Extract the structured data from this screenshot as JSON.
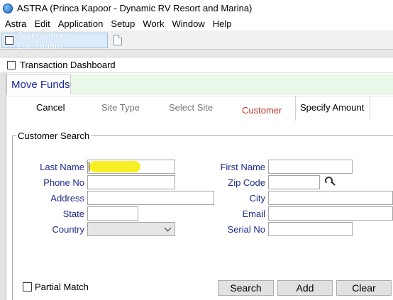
{
  "window": {
    "title": "ASTRA (Princa Kapoor - Dynamic RV Resort and Marina)"
  },
  "menu": [
    "Astra",
    "Edit",
    "Application",
    "Setup",
    "Work",
    "Window",
    "Help"
  ],
  "doc_tab": {
    "label": "Transaction Dashboard"
  },
  "inner_window": {
    "title": "Transaction Dashboard"
  },
  "page_tab": {
    "label": "Move Funds"
  },
  "steps": {
    "cancel": "Cancel",
    "site_type": "Site Type",
    "select_site": "Select Site",
    "customer": "Customer",
    "specify_amount": "Specify Amount"
  },
  "group": {
    "label": "Customer Search"
  },
  "form": {
    "last_name": {
      "label": "Last Name",
      "value": ""
    },
    "phone_no": {
      "label": "Phone No",
      "value": ""
    },
    "address": {
      "label": "Address",
      "value": ""
    },
    "state": {
      "label": "State",
      "value": ""
    },
    "country": {
      "label": "Country",
      "value": ""
    },
    "first_name": {
      "label": "First Name",
      "value": ""
    },
    "zip_code": {
      "label": "Zip Code",
      "value": ""
    },
    "city": {
      "label": "City",
      "value": ""
    },
    "email": {
      "label": "Email",
      "value": ""
    },
    "serial_no": {
      "label": "Serial No",
      "value": ""
    }
  },
  "partial_match": {
    "label": "Partial Match",
    "checked": false
  },
  "buttons": {
    "search": "Search",
    "add": "Add",
    "clear": "Clear"
  },
  "colors": {
    "label_blue": "#1f2a8a",
    "active_step": "#c0352b",
    "highlight": "#f7ee18"
  }
}
